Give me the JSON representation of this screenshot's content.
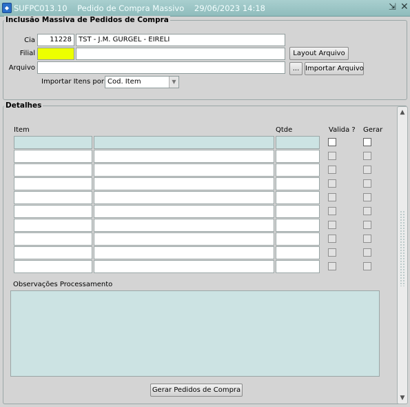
{
  "window": {
    "app_icon": "oracle-forms-icon",
    "title": "SUFPC013.10    Pedido de Compra Massivo    29/06/2023 14:18",
    "minimize_icon": "minimize-icon",
    "close_icon": "close-icon"
  },
  "inclusao": {
    "title": "Inclusão Massiva de Pedidos de Compra",
    "cia_label": "Cia",
    "cia_code": "11228",
    "cia_name": "TST - J.M. GURGEL - EIRELI",
    "filial_label": "Filial",
    "filial_code": "",
    "filial_name": "",
    "arquivo_label": "Arquivo",
    "arquivo_value": "",
    "layout_button": "Layout Arquivo",
    "browse_button": "...",
    "importar_button": "Importar Arquivo",
    "importar_itens_label": "Importar Itens por:",
    "importar_itens_value": "Cod. Item",
    "highlight_color": "#ecff00"
  },
  "detalhes": {
    "title": "Detalhes",
    "col_item": "Item",
    "col_qtde": "Qtde",
    "col_valida": "Valida ?",
    "col_gerar": "Gerar",
    "rows": [
      {
        "item": "",
        "descricao": "",
        "qtde": ""
      },
      {
        "item": "",
        "descricao": "",
        "qtde": ""
      },
      {
        "item": "",
        "descricao": "",
        "qtde": ""
      },
      {
        "item": "",
        "descricao": "",
        "qtde": ""
      },
      {
        "item": "",
        "descricao": "",
        "qtde": ""
      },
      {
        "item": "",
        "descricao": "",
        "qtde": ""
      },
      {
        "item": "",
        "descricao": "",
        "qtde": ""
      },
      {
        "item": "",
        "descricao": "",
        "qtde": ""
      },
      {
        "item": "",
        "descricao": "",
        "qtde": ""
      },
      {
        "item": "",
        "descricao": "",
        "qtde": ""
      }
    ],
    "obs_label": "Observações Processamento",
    "obs_value": "",
    "gerar_button": "Gerar Pedidos de Compra"
  }
}
